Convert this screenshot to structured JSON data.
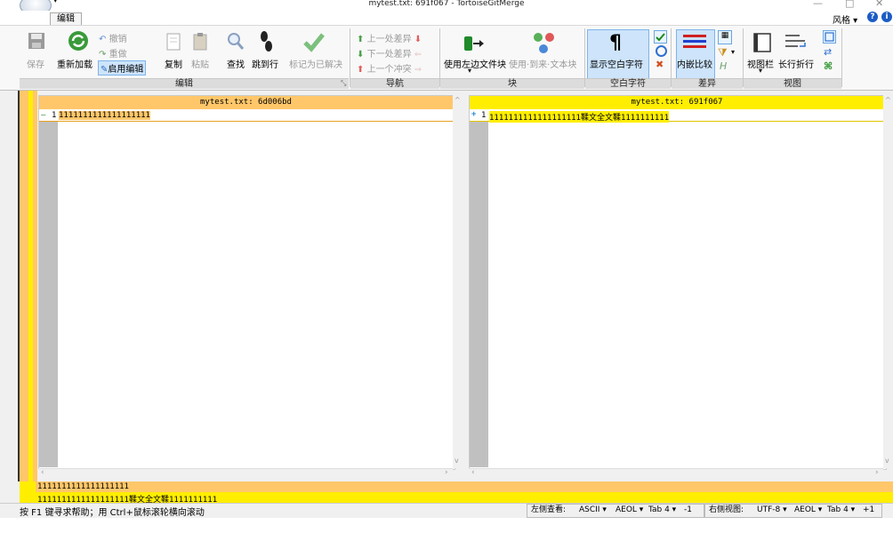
{
  "window": {
    "title": "mytest.txt: 691f067 - TortoiseGitMerge",
    "minimize": "—",
    "maximize": "□",
    "close": "✕"
  },
  "ribbon": {
    "tab": "编辑",
    "style_menu": "风格 ▾",
    "help": "?",
    "info": "i",
    "groups": {
      "edit": {
        "label": "编辑",
        "save": "保存",
        "reload": "重新加载",
        "undo": "撤销",
        "redo": "重做",
        "enable_edit": "启用编辑",
        "copy": "复制",
        "paste": "粘贴",
        "find": "查找",
        "goto_line": "跳到行",
        "mark_resolved": "标记为已解决"
      },
      "navigate": {
        "label": "导航",
        "prev_diff": "上一处差异",
        "next_diff": "下一处差异",
        "prev_conflict": "上一个冲突"
      },
      "block": {
        "label": "块",
        "use_left_block": "使用左边文件块",
        "use_from_to": "使用·到来·文本块"
      },
      "whitespace": {
        "label": "空白字符",
        "show_whitespace": "显示空白字符"
      },
      "diff": {
        "label": "差异",
        "inline_diff": "内嵌比较"
      },
      "view": {
        "label": "视图",
        "view_bar": "视图栏",
        "long_line_wrap": "长行折行"
      }
    }
  },
  "left_pane": {
    "header": "mytest.txt: 6d006bd",
    "line_number": "1",
    "marker": "—",
    "line_text": "1111111111111111111"
  },
  "right_pane": {
    "header": "mytest.txt: 691f067",
    "line_number": "1",
    "marker": "+",
    "line_text": "1111111111111111111鞣文全文鞣1111111111"
  },
  "bottom_diff": {
    "line1": "1111111111111111111",
    "line2": "1111111111111111111鞣文全文鞣1111111111"
  },
  "statusbar": {
    "help_text": "按 F1 键寻求帮助；用 Ctrl+鼠标滚轮横向滚动",
    "left_view_label": "左侧查看:",
    "left_encoding": "ASCII ▾",
    "left_eol": "AEOL ▾",
    "left_tab": "Tab 4 ▾",
    "left_offset": "-1",
    "right_view_label": "右侧视图:",
    "right_encoding": "UTF-8 ▾",
    "right_eol": "AEOL ▾",
    "right_tab": "Tab 4 ▾",
    "right_offset": "+1"
  },
  "colors": {
    "left_change": "#ffc76a",
    "right_change": "#ffee00",
    "highlight": "#cde4fb"
  }
}
